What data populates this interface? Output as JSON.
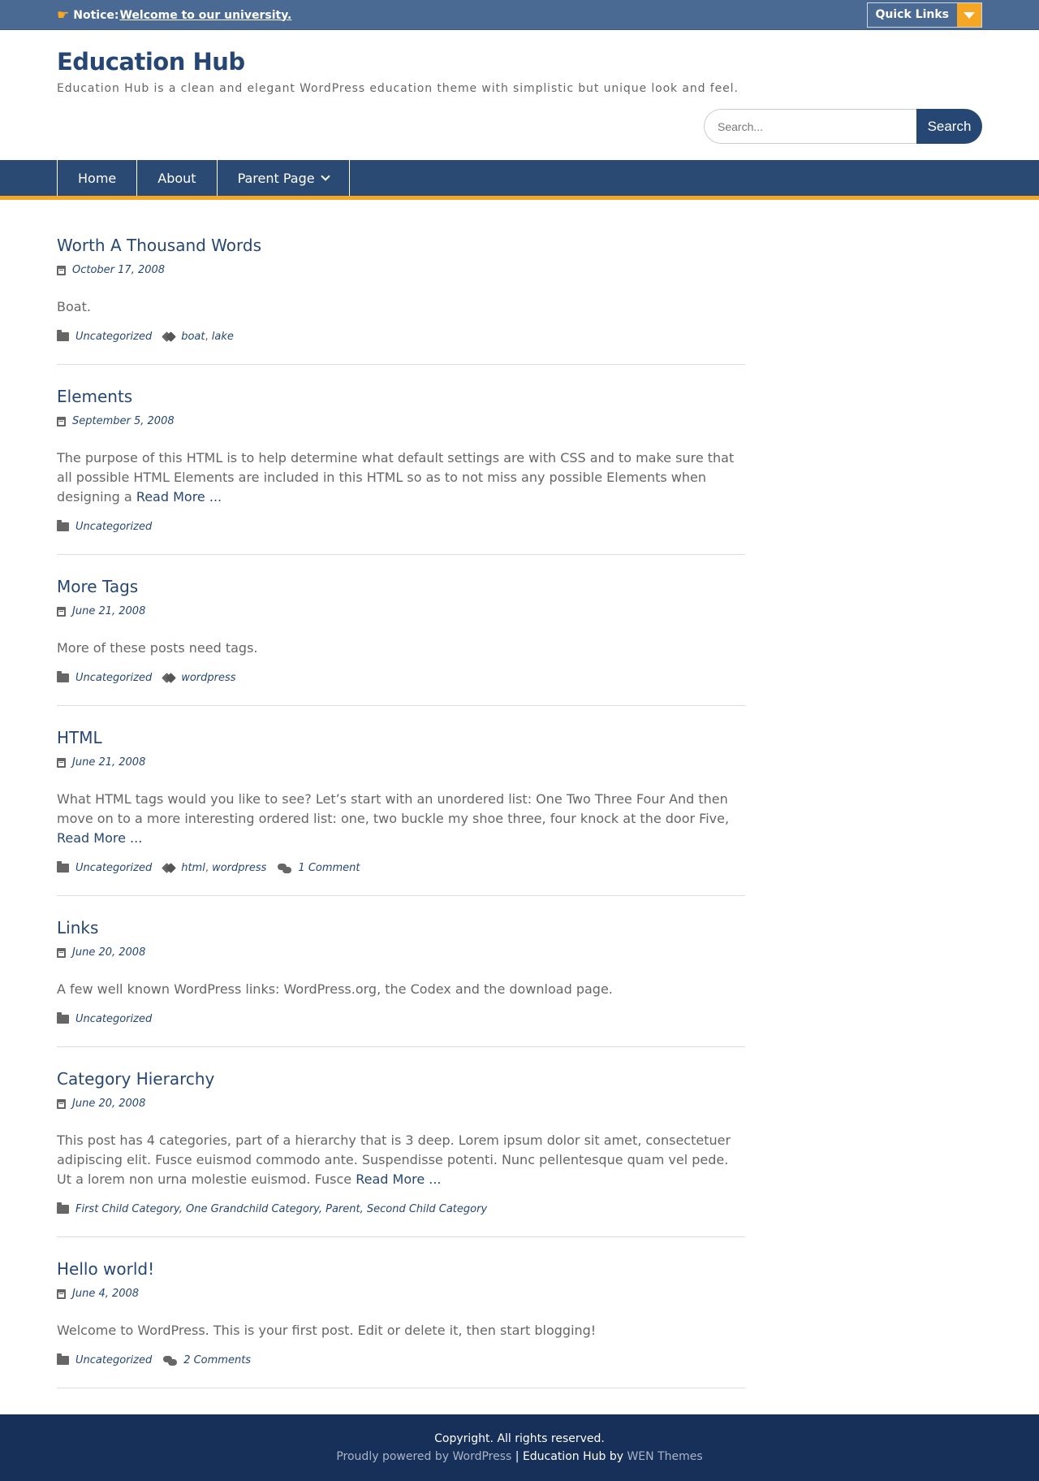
{
  "topbar": {
    "notice_label": "Notice:",
    "notice_link": "Welcome to our university.",
    "quick_links_label": "Quick Links"
  },
  "header": {
    "site_title": "Education Hub",
    "site_description": "Education Hub is a clean and elegant WordPress education theme with simplistic but unique look and feel.",
    "search_placeholder": "Search...",
    "search_button": "Search"
  },
  "nav": {
    "items": [
      "Home",
      "About",
      "Parent Page"
    ]
  },
  "posts": [
    {
      "title": "Worth A Thousand Words",
      "date": "October 17, 2008",
      "excerpt": "Boat.",
      "more": "",
      "categories": "Uncategorized",
      "tags": [
        "boat",
        "lake"
      ],
      "comments": ""
    },
    {
      "title": "Elements",
      "date": "September 5, 2008",
      "excerpt": "The purpose of this HTML is to help determine what default settings are with CSS and to make sure that all possible HTML Elements are included in this HTML so as to not miss any possible Elements when designing a",
      "more": "Read More ...",
      "categories": "Uncategorized",
      "tags": [],
      "comments": ""
    },
    {
      "title": "More Tags",
      "date": "June 21, 2008",
      "excerpt": "More of these posts need tags.",
      "more": "",
      "categories": "Uncategorized",
      "tags": [
        "wordpress"
      ],
      "comments": ""
    },
    {
      "title": "HTML",
      "date": "June 21, 2008",
      "excerpt": "What HTML tags would you like to see? Let’s start with an unordered list: One Two Three Four And then move on to a more interesting ordered list: one, two buckle my shoe three, four knock at the door Five,",
      "more": "Read More ...",
      "categories": "Uncategorized",
      "tags": [
        "html",
        "wordpress"
      ],
      "comments": "1 Comment"
    },
    {
      "title": "Links",
      "date": "June 20, 2008",
      "excerpt": "A few well known WordPress links: WordPress.org, the Codex and the download page.",
      "more": "",
      "categories": "Uncategorized",
      "tags": [],
      "comments": ""
    },
    {
      "title": "Category Hierarchy",
      "date": "June 20, 2008",
      "excerpt": "This post has 4 categories, part of a hierarchy that is 3 deep. Lorem ipsum dolor sit amet, consectetuer adipiscing elit. Fusce euismod commodo ante. Suspendisse potenti. Nunc pellentesque quam vel pede. Ut a lorem non urna molestie euismod. Fusce",
      "more": "Read More ...",
      "categories": "First Child Category, One Grandchild Category, Parent, Second Child Category",
      "tags": [],
      "comments": ""
    },
    {
      "title": "Hello world!",
      "date": "June 4, 2008",
      "excerpt": "Welcome to WordPress. This is your first post. Edit or delete it, then start blogging!",
      "more": "",
      "categories": "Uncategorized",
      "tags": [],
      "comments": "2 Comments"
    }
  ],
  "footer": {
    "copyright": "Copyright. All rights reserved.",
    "powered_by": "Proudly powered by WordPress",
    "separator": "|",
    "theme_name": "Education Hub by",
    "theme_author": "WEN Themes"
  },
  "colors": {
    "topbar": "#4a6a94",
    "primary": "#264773",
    "accent": "#f5a623",
    "footer": "#17305a"
  }
}
